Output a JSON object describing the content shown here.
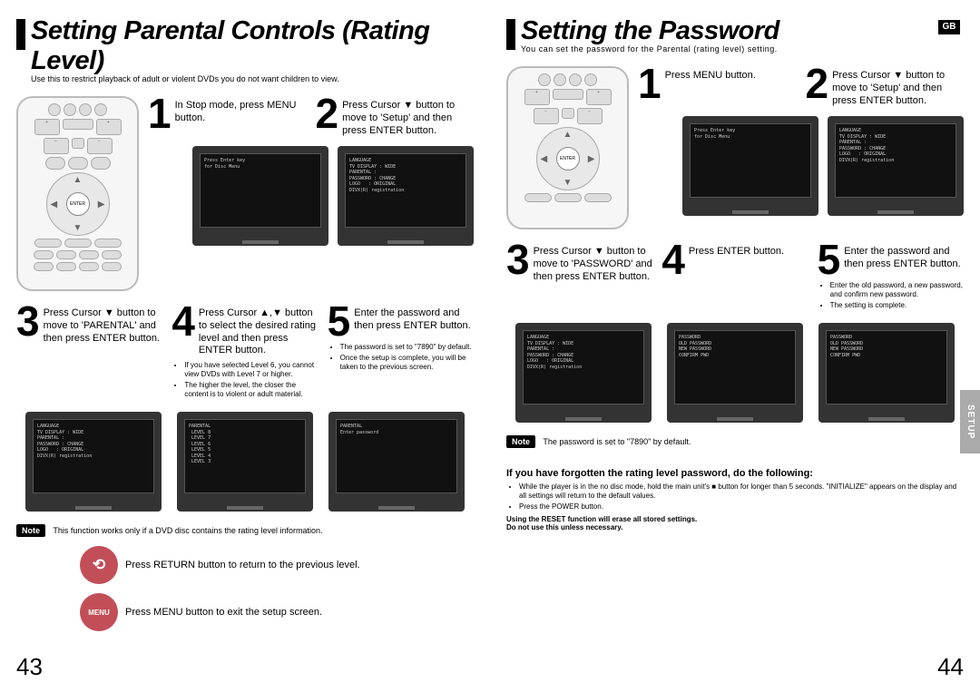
{
  "left": {
    "title": "Setting Parental Controls (Rating Level)",
    "subtitle": "Use this to restrict playback of adult or violent DVDs you do not want children to view.",
    "step1": "In Stop mode, press MENU button.",
    "step2": "Press Cursor ▼ button to move to 'Setup' and then press ENTER button.",
    "step3": "Press Cursor ▼ button to move to 'PARENTAL' and then press ENTER button.",
    "step4": "Press Cursor ▲,▼ button to select the desired rating level and then press ENTER button.",
    "step4_bullets": [
      "If you have selected Level 6, you cannot view DVDs with Level 7 or higher.",
      "The higher the level, the closer the content is to violent or adult material."
    ],
    "step5": "Enter the password and then press ENTER button.",
    "step5_bullets": [
      "The password is set to \"7890\" by default.",
      "Once the setup is complete, you will be taken to the previous screen."
    ],
    "note": "This function works only if a DVD disc contains the rating level information.",
    "footer1": "Press RETURN button to return to the previous level.",
    "footer2": "Press MENU button to exit the setup screen.",
    "pagenum": "43"
  },
  "right": {
    "title": "Setting the Password",
    "subtitle": "You can set the password for the Parental (rating level) setting.",
    "lang": "GB",
    "step1": "Press MENU button.",
    "step2": "Press Cursor ▼ button to move to 'Setup' and then press ENTER button.",
    "step3": "Press Cursor ▼ button to move to 'PASSWORD' and then press ENTER button.",
    "step4": "Press ENTER button.",
    "step5": "Enter the password and then press ENTER button.",
    "step5_bullets": [
      "Enter the old password, a new password, and confirm new password.",
      "The setting is complete."
    ],
    "note": "The password is set to \"7890\" by default.",
    "forgot_heading": "If you have forgotten the rating level password, do the following:",
    "forgot_b1": "While the player is in the no disc mode, hold the main unit's ■ button for longer than 5 seconds. \"INITIALIZE\" appears on the display and all settings will return to the default values.",
    "forgot_b2": "Press the POWER button.",
    "forgot_warn1": "Using the RESET function will erase all stored settings.",
    "forgot_warn2": "Do not use this unless necessary.",
    "tab": "SETUP",
    "pagenum": "44"
  },
  "tv": {
    "menu": "Press Enter key\nfor Disc Menu",
    "setup": "LANGUAGE\nTV DISPLAY : WIDE\nPARENTAL : \nPASSWORD : CHANGE\nLOGO   : ORIGINAL\nDIVX(R) registration",
    "parental": "PARENTAL\n LEVEL 8\n LEVEL 7\n LEVEL 6\n LEVEL 5\n LEVEL 4\n LEVEL 3",
    "password": "PARENTAL\nEnter password",
    "pwchange": "PASSWORD\nOLD PASSWORD\nNEW PASSWORD\nCONFIRM PWD"
  }
}
